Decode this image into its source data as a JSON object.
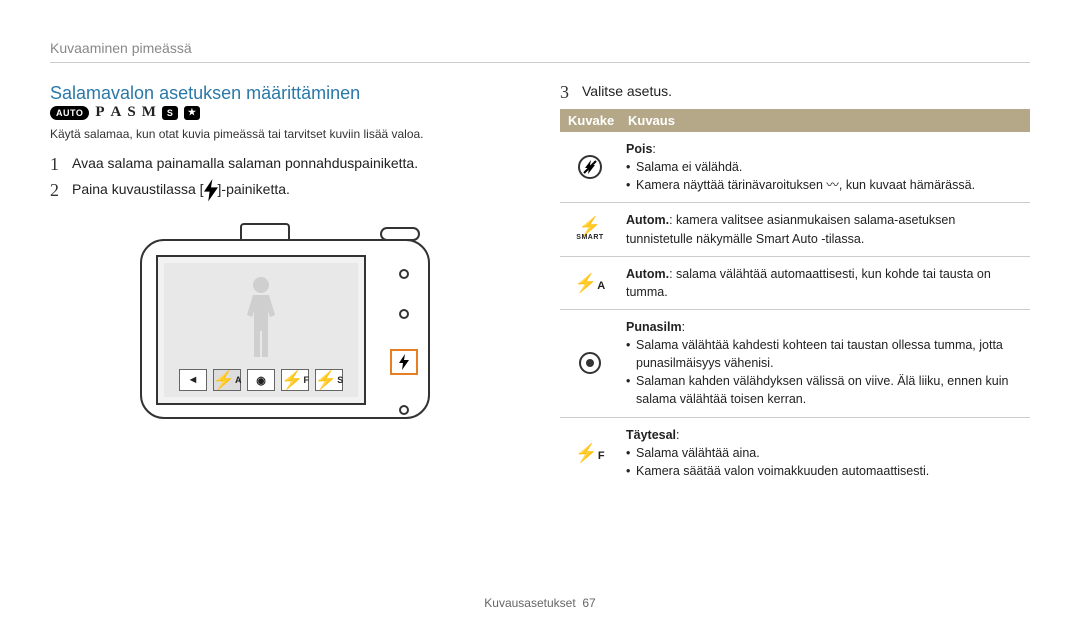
{
  "header": {
    "breadcrumb": "Kuvaaminen pimeässä"
  },
  "left": {
    "title": "Salamavalon asetuksen määrittäminen",
    "modes": {
      "auto_label": "AUTO",
      "p": "P",
      "a": "A",
      "s": "S",
      "m": "M",
      "scene": "S",
      "smart": "★"
    },
    "intro": "Käytä salamaa, kun otat kuvia pimeässä tai tarvitset kuviin lisää valoa.",
    "steps": [
      {
        "idx": "1",
        "text": "Avaa salama painamalla salaman ponnahduspainiketta."
      },
      {
        "idx": "2",
        "text_before": "Paina kuvaustilassa [",
        "text_after": "]-painiketta."
      }
    ],
    "camera_icons": {
      "off": "⦸",
      "auto": "⚡A",
      "redeye": "◉",
      "fill": "⚡F",
      "slow": "⚡S"
    }
  },
  "right": {
    "step": {
      "idx": "3",
      "text": "Valitse asetus."
    },
    "headers": {
      "icon": "Kuvake",
      "desc": "Kuvaus"
    },
    "rows": [
      {
        "icon_name": "flash-off-icon",
        "title": "Pois",
        "lines": [
          "Salama ei välähdä.",
          "Kamera näyttää tärinävaroituksen 〰, kun kuvaat hämärässä."
        ]
      },
      {
        "icon_name": "flash-smart-icon",
        "title": "Autom.",
        "plain": ": kamera valitsee asianmukaisen salama-asetuksen tunnistetulle näkymälle Smart Auto -tilassa."
      },
      {
        "icon_name": "flash-auto-icon",
        "title": "Autom.",
        "plain": ": salama välähtää automaattisesti, kun kohde tai tausta on tumma."
      },
      {
        "icon_name": "flash-redeye-icon",
        "title": "Punasilm",
        "lines": [
          "Salama välähtää kahdesti kohteen tai taustan ollessa tumma, jotta punasilmäisyys vähenisi.",
          "Salaman kahden välähdyksen välissä on viive. Älä liiku, ennen kuin salama välähtää toisen kerran."
        ]
      },
      {
        "icon_name": "flash-fill-icon",
        "title": "Täytesal",
        "lines": [
          "Salama välähtää aina.",
          "Kamera säätää valon voimakkuuden automaattisesti."
        ]
      }
    ]
  },
  "footer": {
    "section": "Kuvausasetukset",
    "page": "67"
  }
}
